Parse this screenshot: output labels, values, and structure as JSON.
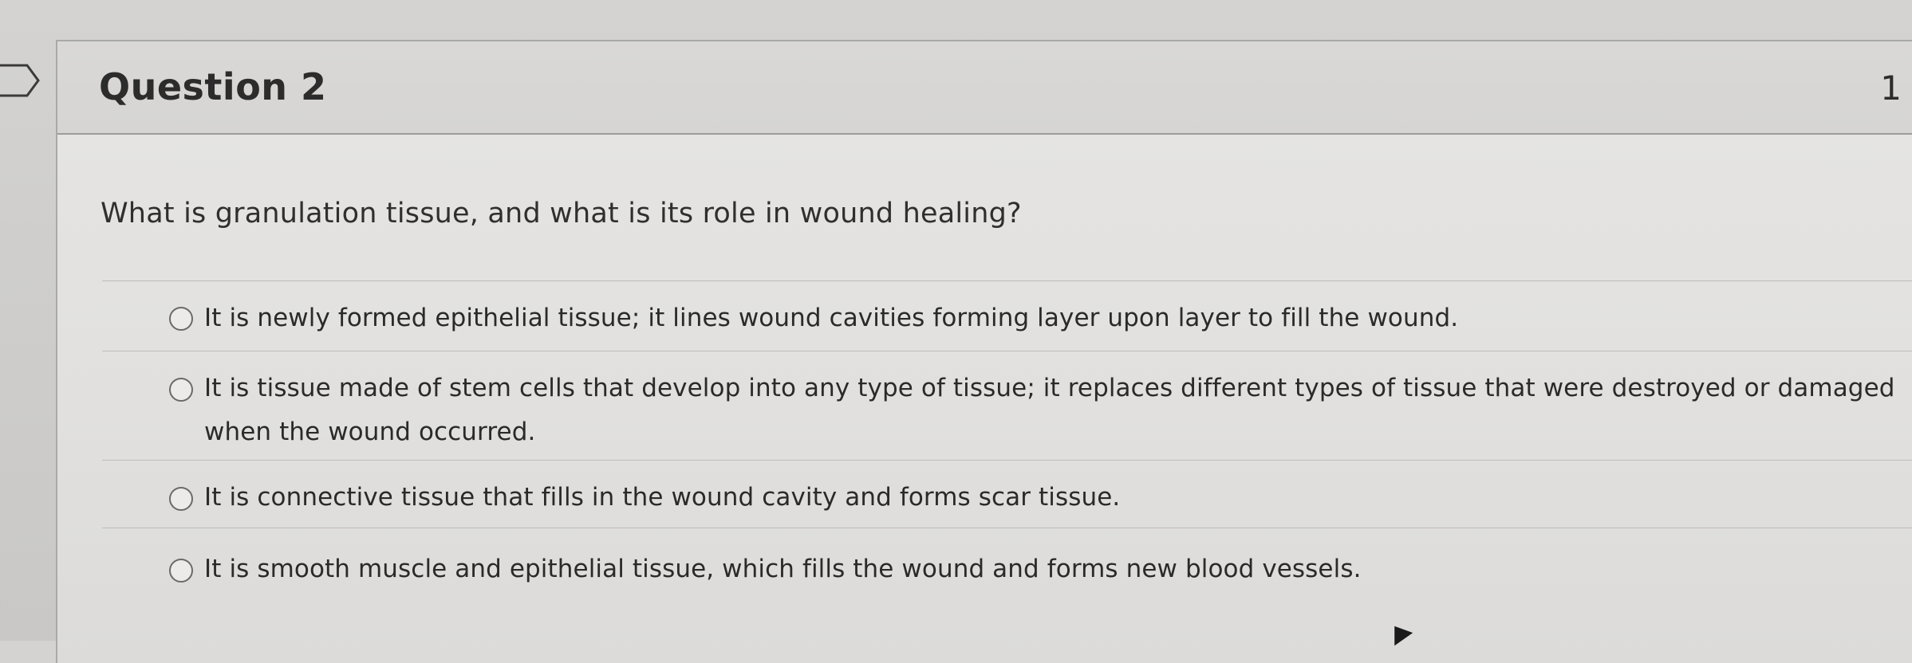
{
  "question": {
    "title": "Question 2",
    "points": "1",
    "text": "What is granulation tissue, and what is its role in wound healing?"
  },
  "answers": [
    {
      "label": "It is newly formed epithelial tissue; it lines wound cavities forming layer upon layer to fill the wound.",
      "selected": false
    },
    {
      "label": "It is tissue made of stem cells that develop into any type of tissue; it replaces different types of tissue that were destroyed or damaged when the wound occurred.",
      "selected": false
    },
    {
      "label": "It is connective tissue that fills in the wound cavity and forms scar tissue.",
      "selected": false
    },
    {
      "label": "It is smooth muscle and epithelial tissue, which fills the wound and forms new blood vessels.",
      "selected": false
    }
  ],
  "icons": {
    "flag": "flag-tab-icon",
    "radio": "radio-button-icon",
    "cursor": "mouse-cursor-icon"
  },
  "colors": {
    "background": "#d0cfcd",
    "card": "#e3e2e0",
    "header": "#d8d7d5",
    "text": "#2a2a2a",
    "divider": "#bdbcba"
  }
}
